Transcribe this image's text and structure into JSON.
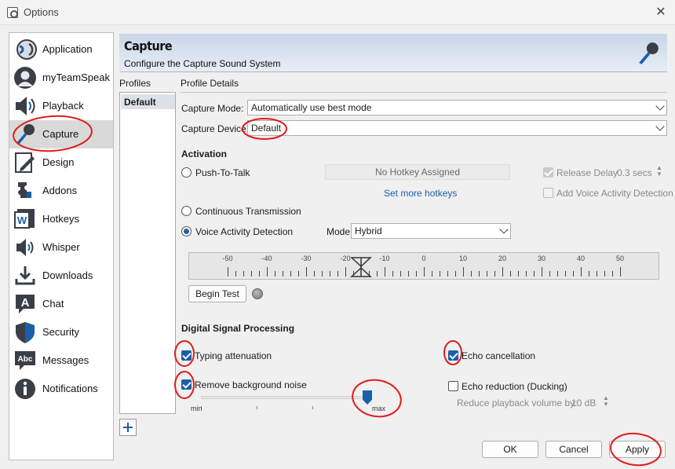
{
  "window": {
    "title": "Options"
  },
  "sidebar": {
    "items": [
      {
        "label": "Application",
        "icon": "application-icon"
      },
      {
        "label": "myTeamSpeak",
        "icon": "user-icon"
      },
      {
        "label": "Playback",
        "icon": "speaker-icon"
      },
      {
        "label": "Capture",
        "icon": "microphone-icon",
        "selected": true
      },
      {
        "label": "Design",
        "icon": "design-pen-icon"
      },
      {
        "label": "Addons",
        "icon": "puzzle-icon"
      },
      {
        "label": "Hotkeys",
        "icon": "keyboard-icon"
      },
      {
        "label": "Whisper",
        "icon": "whisper-icon"
      },
      {
        "label": "Downloads",
        "icon": "download-icon"
      },
      {
        "label": "Chat",
        "icon": "chat-icon"
      },
      {
        "label": "Security",
        "icon": "shield-icon"
      },
      {
        "label": "Messages",
        "icon": "messages-icon"
      },
      {
        "label": "Notifications",
        "icon": "info-icon"
      }
    ]
  },
  "header": {
    "title": "Capture",
    "subtitle": "Configure the Capture Sound System"
  },
  "profiles": {
    "label": "Profiles",
    "items": [
      "Default"
    ]
  },
  "details": {
    "label": "Profile Details",
    "capture_mode_label": "Capture Mode:",
    "capture_mode_value": "Automatically use best mode",
    "capture_device_label": "Capture Device:",
    "capture_device_value": "Default"
  },
  "activation": {
    "title": "Activation",
    "push_to_talk": "Push-To-Talk",
    "hotkey_placeholder": "No Hotkey Assigned",
    "set_more_hotkeys": "Set more hotkeys",
    "release_delay_label": "Release Delay",
    "release_delay_checked": true,
    "release_delay_value": "0.3 secs",
    "add_vad_label": "Add Voice Activity Detection",
    "add_vad_checked": false,
    "continuous": "Continuous Transmission",
    "vad": "Voice Activity Detection",
    "selected": "vad",
    "mode_label": "Mode",
    "mode_value": "Hybrid"
  },
  "meter": {
    "scale": [
      "-50",
      "-40",
      "-30",
      "-20",
      "-10",
      "0",
      "10",
      "20",
      "30",
      "40",
      "50"
    ],
    "threshold": -16
  },
  "test": {
    "begin_test": "Begin Test"
  },
  "dsp": {
    "title": "Digital Signal Processing",
    "typing_attenuation": "Typing attenuation",
    "typing_attenuation_checked": true,
    "echo_cancellation": "Echo cancellation",
    "echo_cancellation_checked": true,
    "remove_noise": "Remove background noise",
    "remove_noise_checked": true,
    "noise_min": "min",
    "noise_max": "max",
    "noise_level": 1.0,
    "echo_reduction": "Echo reduction (Ducking)",
    "echo_reduction_checked": false,
    "reduce_playback_label": "Reduce playback volume by:",
    "reduce_playback_value": "10 dB"
  },
  "footer": {
    "ok": "OK",
    "cancel": "Cancel",
    "apply": "Apply"
  },
  "colors": {
    "accent": "#1b5faa",
    "annotation": "#e01b1b",
    "header_gradient_top": "#c9d6e8"
  }
}
